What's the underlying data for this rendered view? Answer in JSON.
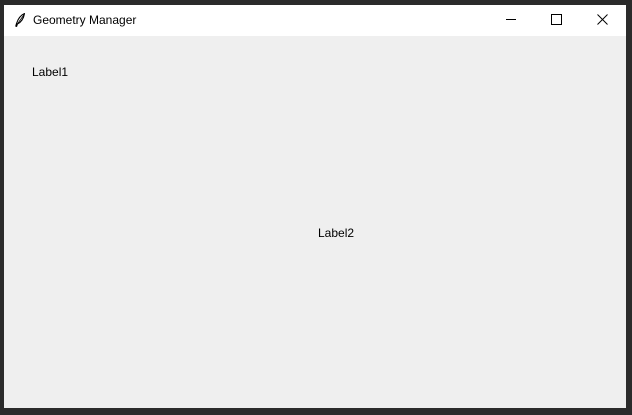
{
  "window": {
    "title": "Geometry Manager",
    "app_icon": "feather-icon",
    "controls": {
      "minimize_icon": "minimize-icon",
      "maximize_icon": "maximize-icon",
      "close_icon": "close-icon"
    }
  },
  "content": {
    "label1": "Label1",
    "label2": "Label2"
  },
  "colors": {
    "titlebar_bg": "#ffffff",
    "client_bg": "#efefef",
    "frame": "#2b2b2b",
    "text": "#000000"
  }
}
